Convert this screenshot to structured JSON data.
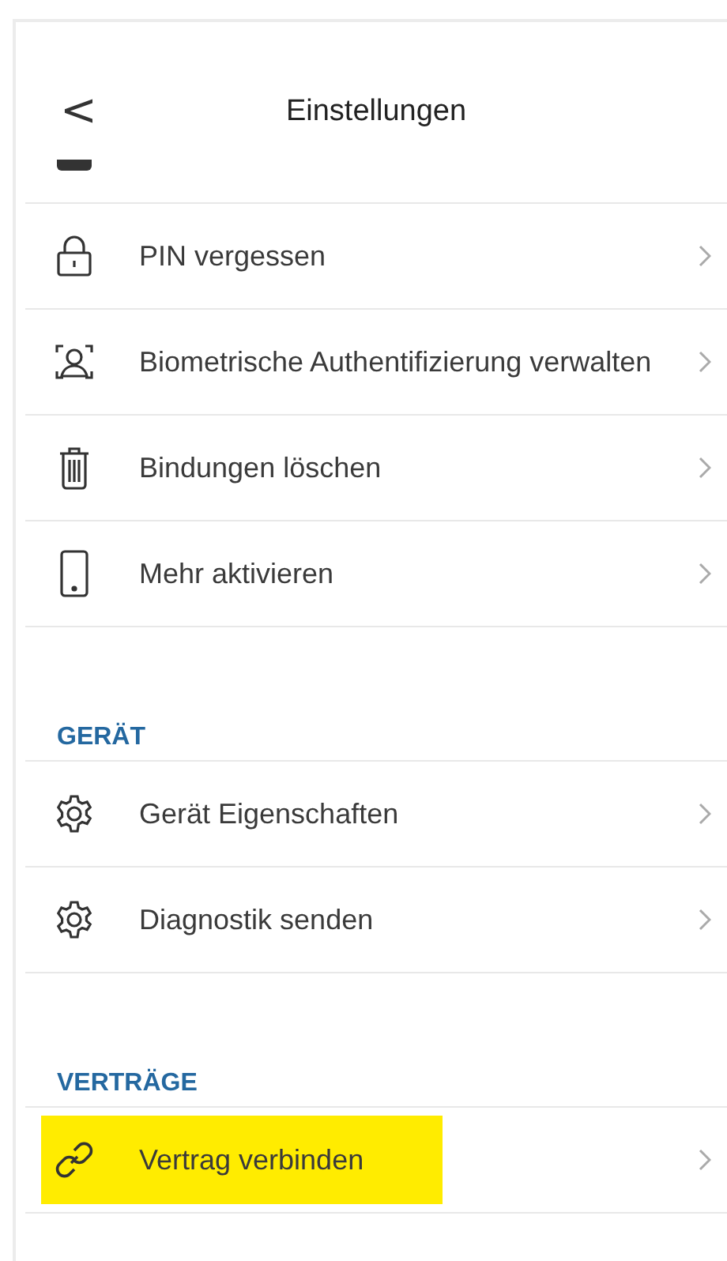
{
  "header": {
    "back": "<",
    "title": "Einstellungen"
  },
  "sections": [
    {
      "items": [
        {
          "label": "PIN vergessen",
          "highlighted": false
        },
        {
          "label": "Biometrische Authentifizierung verwalten",
          "highlighted": false
        },
        {
          "label": "Bindungen löschen",
          "highlighted": false
        },
        {
          "label": "Mehr aktivieren",
          "highlighted": false
        }
      ]
    },
    {
      "heading": "GERÄT",
      "items": [
        {
          "label": "Gerät Eigenschaften",
          "highlighted": false
        },
        {
          "label": "Diagnostik senden",
          "highlighted": false
        }
      ]
    },
    {
      "heading": "VERTRÄGE",
      "items": [
        {
          "label": "Vertrag verbinden",
          "highlighted": true
        }
      ]
    }
  ]
}
